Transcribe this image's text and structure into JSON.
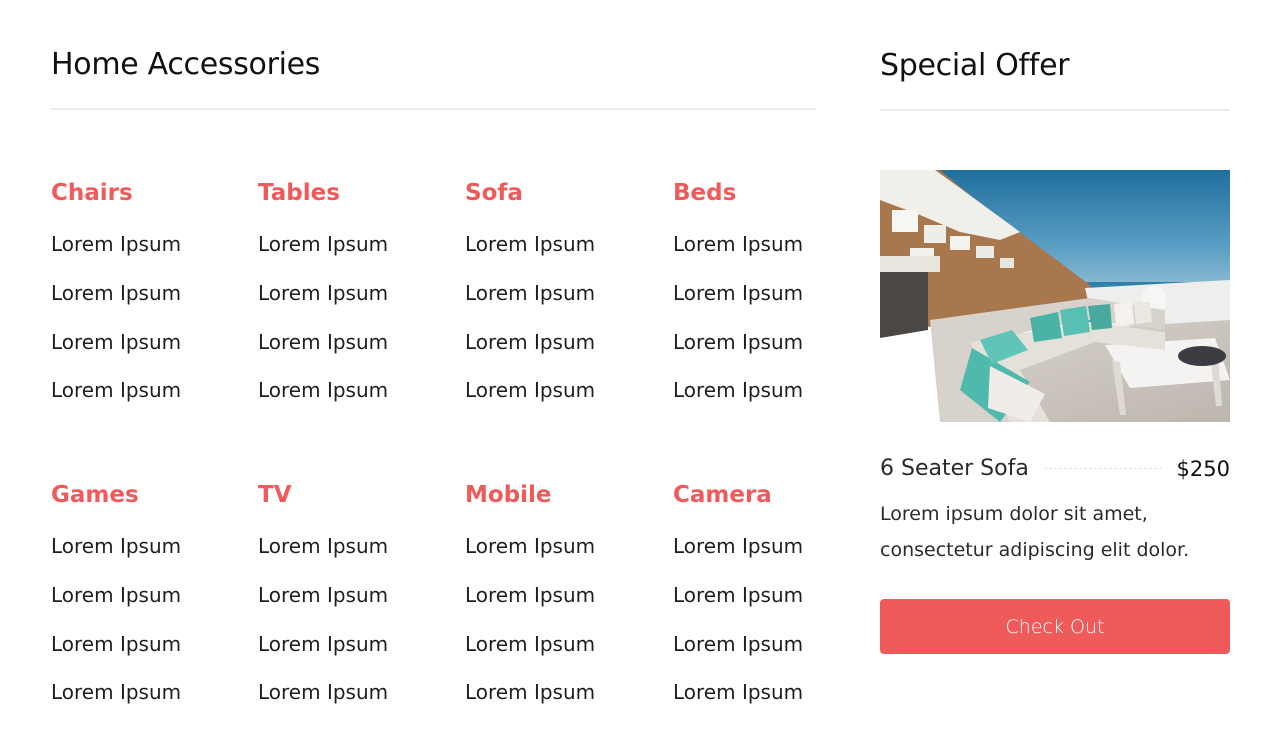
{
  "accessories": {
    "title": "Home Accessories",
    "categories": [
      {
        "heading": "Chairs",
        "items": [
          "Lorem Ipsum",
          "Lorem Ipsum",
          "Lorem Ipsum",
          "Lorem Ipsum"
        ]
      },
      {
        "heading": "Tables",
        "items": [
          "Lorem Ipsum",
          "Lorem Ipsum",
          "Lorem Ipsum",
          "Lorem Ipsum"
        ]
      },
      {
        "heading": "Sofa",
        "items": [
          "Lorem Ipsum",
          "Lorem Ipsum",
          "Lorem Ipsum",
          "Lorem Ipsum"
        ]
      },
      {
        "heading": "Beds",
        "items": [
          "Lorem Ipsum",
          "Lorem Ipsum",
          "Lorem Ipsum",
          "Lorem Ipsum"
        ]
      },
      {
        "heading": "Games",
        "items": [
          "Lorem Ipsum",
          "Lorem Ipsum",
          "Lorem Ipsum",
          "Lorem Ipsum"
        ]
      },
      {
        "heading": "TV",
        "items": [
          "Lorem Ipsum",
          "Lorem Ipsum",
          "Lorem Ipsum",
          "Lorem Ipsum"
        ]
      },
      {
        "heading": "Mobile",
        "items": [
          "Lorem Ipsum",
          "Lorem Ipsum",
          "Lorem Ipsum",
          "Lorem Ipsum"
        ]
      },
      {
        "heading": "Camera",
        "items": [
          "Lorem Ipsum",
          "Lorem Ipsum",
          "Lorem Ipsum",
          "Lorem Ipsum"
        ]
      }
    ]
  },
  "offer": {
    "title": "Special Offer",
    "product_name": "6 Seater Sofa",
    "price": "$250",
    "description": "Lorem ipsum dolor sit amet, consectetur adipiscing elit dolor.",
    "button_label": "Check Out"
  },
  "colors": {
    "accent": "#ef5a5a",
    "heading_text": "#111111",
    "body_text": "#1f1f1f",
    "divider": "#ececec",
    "button_text": "#ffffff"
  }
}
